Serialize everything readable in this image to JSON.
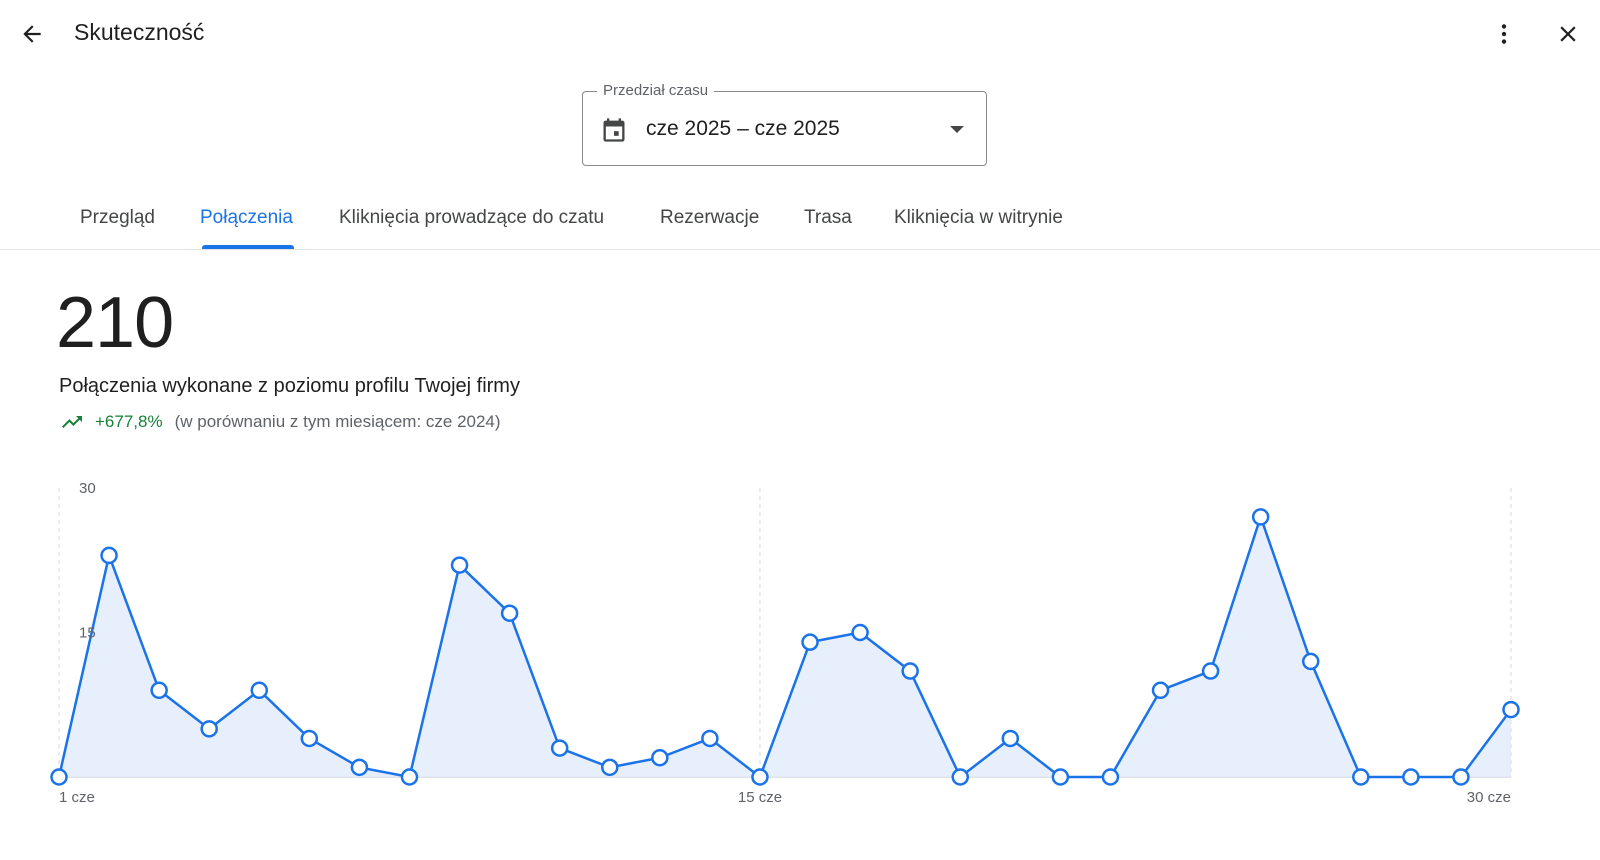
{
  "header": {
    "title": "Skuteczność",
    "back_icon": "arrow-back-icon",
    "more_icon": "more-vert-icon",
    "close_icon": "close-icon"
  },
  "date_range": {
    "label": "Przedział czasu",
    "value": "cze 2025 – cze 2025",
    "icon": "calendar-icon",
    "dropdown_icon": "arrow-drop-down-icon"
  },
  "tabs": [
    {
      "label": "Przegląd",
      "active": false
    },
    {
      "label": "Połączenia",
      "active": true
    },
    {
      "label": "Kliknięcia prowadzące do czatu",
      "active": false
    },
    {
      "label": "Rezerwacje",
      "active": false
    },
    {
      "label": "Trasa",
      "active": false
    },
    {
      "label": "Kliknięcia w witrynie",
      "active": false
    }
  ],
  "summary": {
    "total": "210",
    "description": "Połączenia wykonane z poziomu profilu Twojej firmy",
    "trend_icon": "trending-up-icon",
    "change": "+677,8%",
    "comparison": "(w porównaniu z tym miesiącem: cze 2024)"
  },
  "colors": {
    "accent": "#1a73e8",
    "positive": "#188038",
    "area_fill": "#e3ebfb"
  },
  "chart_data": {
    "type": "area",
    "x": [
      1,
      2,
      3,
      4,
      5,
      6,
      7,
      8,
      9,
      10,
      11,
      12,
      13,
      14,
      15,
      16,
      17,
      18,
      19,
      20,
      21,
      22,
      23,
      24,
      25,
      26,
      27,
      28,
      29,
      30
    ],
    "x_tick_labels": [
      "1 cze",
      "15 cze",
      "30 cze"
    ],
    "x_tick_values": [
      1,
      15,
      30
    ],
    "y_tick_labels": [
      "30",
      "15"
    ],
    "y_tick_values": [
      30,
      15
    ],
    "ylim": [
      0,
      30
    ],
    "series": [
      {
        "values": [
          0,
          23,
          9,
          5,
          9,
          4,
          1,
          0,
          22,
          17,
          3,
          1,
          2,
          4,
          0,
          14,
          15,
          11,
          0,
          4,
          0,
          0,
          9,
          11,
          27,
          12,
          0,
          0,
          0,
          7
        ]
      }
    ]
  }
}
